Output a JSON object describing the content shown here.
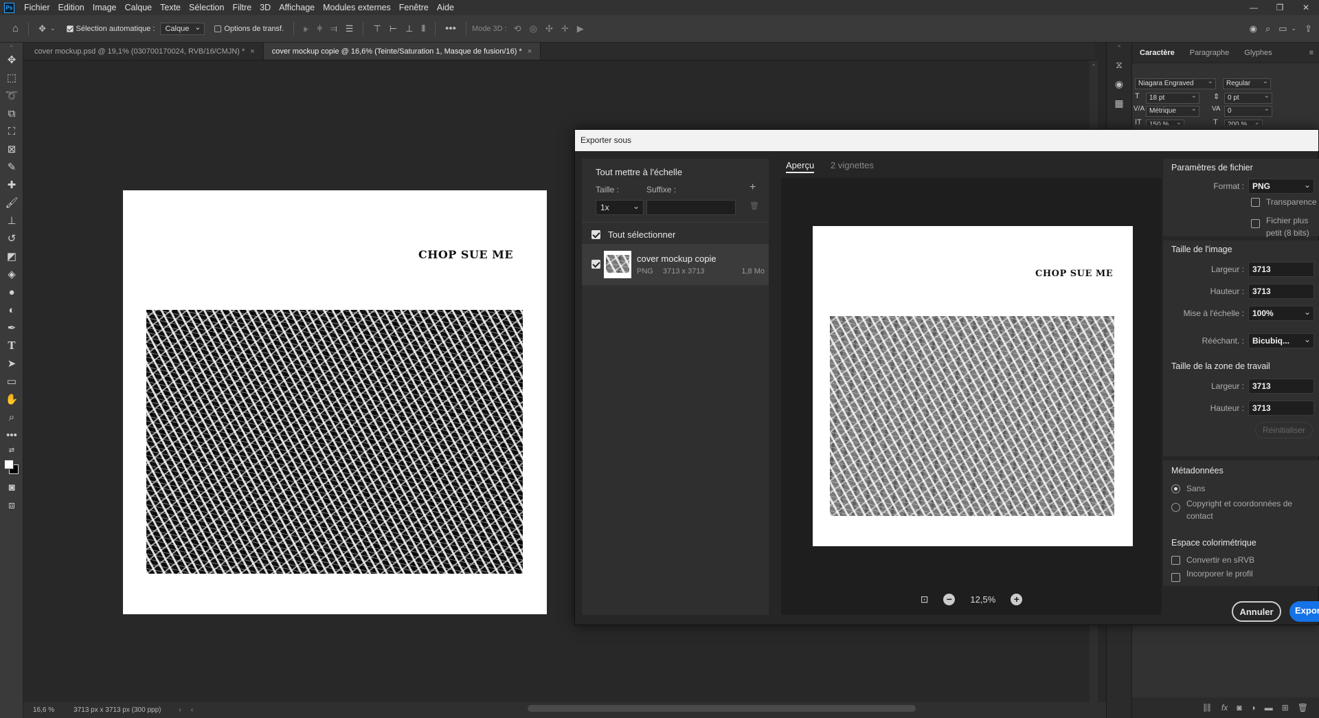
{
  "menubar": {
    "logo": "Ps",
    "items": [
      "Fichier",
      "Edition",
      "Image",
      "Calque",
      "Texte",
      "Sélection",
      "Filtre",
      "3D",
      "Affichage",
      "Modules externes",
      "Fenêtre",
      "Aide"
    ]
  },
  "options_bar": {
    "auto_select_label": "Sélection automatique :",
    "auto_select_value": "Calque",
    "transform_options_label": "Options de transf.",
    "mode_3d_label": "Mode 3D :"
  },
  "doc_tabs": [
    {
      "title": "cover mockup.psd @ 19,1% (030700170024, RVB/16/CMJN) *",
      "active": false
    },
    {
      "title": "cover mockup copie @ 16,6% (Teinte/Saturation 1, Masque de fusion/16) *",
      "active": true
    }
  ],
  "canvas": {
    "cover_title": "CHOP SUE ME"
  },
  "status_bar": {
    "zoom": "16,6 %",
    "doc_info": "3713 px x 3713 px (300 ppp)"
  },
  "character_panel": {
    "tabs": [
      "Caractère",
      "Paragraphe",
      "Glyphes"
    ],
    "font_family": "Niagara Engraved",
    "font_style": "Regular",
    "font_size": "18 pt",
    "leading": "0 pt",
    "kerning": "Métrique",
    "tracking": "0",
    "vertical_scale": "150 %",
    "horizontal_scale": "200 %"
  },
  "export_dialog": {
    "title": "Exporter sous",
    "scale_all": {
      "heading": "Tout mettre à l'échelle",
      "size_label": "Taille :",
      "suffix_label": "Suffixe :",
      "size_value": "1x",
      "suffix_value": ""
    },
    "select_all_label": "Tout sélectionner",
    "asset": {
      "name": "cover mockup copie",
      "format": "PNG",
      "dimensions": "3713 x 3713",
      "size": "1,8 Mo"
    },
    "preview_tabs": [
      "Aperçu",
      "2 vignettes"
    ],
    "preview_title": "CHOP SUE ME",
    "zoom": "12,5%",
    "file_settings": {
      "heading": "Paramètres de fichier",
      "format_label": "Format :",
      "format_value": "PNG",
      "transparency_label": "Transparence",
      "smaller_file_label": "Fichier plus petit (8 bits)"
    },
    "image_size": {
      "heading": "Taille de l'image",
      "width_label": "Largeur :",
      "width_value": "3713",
      "height_label": "Hauteur :",
      "height_value": "3713",
      "scale_label": "Mise à l'échelle :",
      "scale_value": "100%",
      "resample_label": "Rééchant. :",
      "resample_value": "Bicubiq..."
    },
    "canvas_size": {
      "heading": "Taille de la zone de travail",
      "width_label": "Largeur :",
      "width_value": "3713",
      "height_label": "Hauteur :",
      "height_value": "3713",
      "reset_label": "Réinitialiser"
    },
    "metadata": {
      "heading": "Métadonnées",
      "none_label": "Sans",
      "copyright_label": "Copyright et coordonnées de contact"
    },
    "color_space": {
      "heading": "Espace colorimétrique",
      "convert_srgb_label": "Convertir en sRVB",
      "embed_profile_label": "Incorporer le profil"
    },
    "cancel_label": "Annuler",
    "export_label": "Exporter"
  },
  "colors": {
    "accent_blue": "#1473e6",
    "dialog_bg": "#262626",
    "panel_bg": "#2f2f2f"
  }
}
